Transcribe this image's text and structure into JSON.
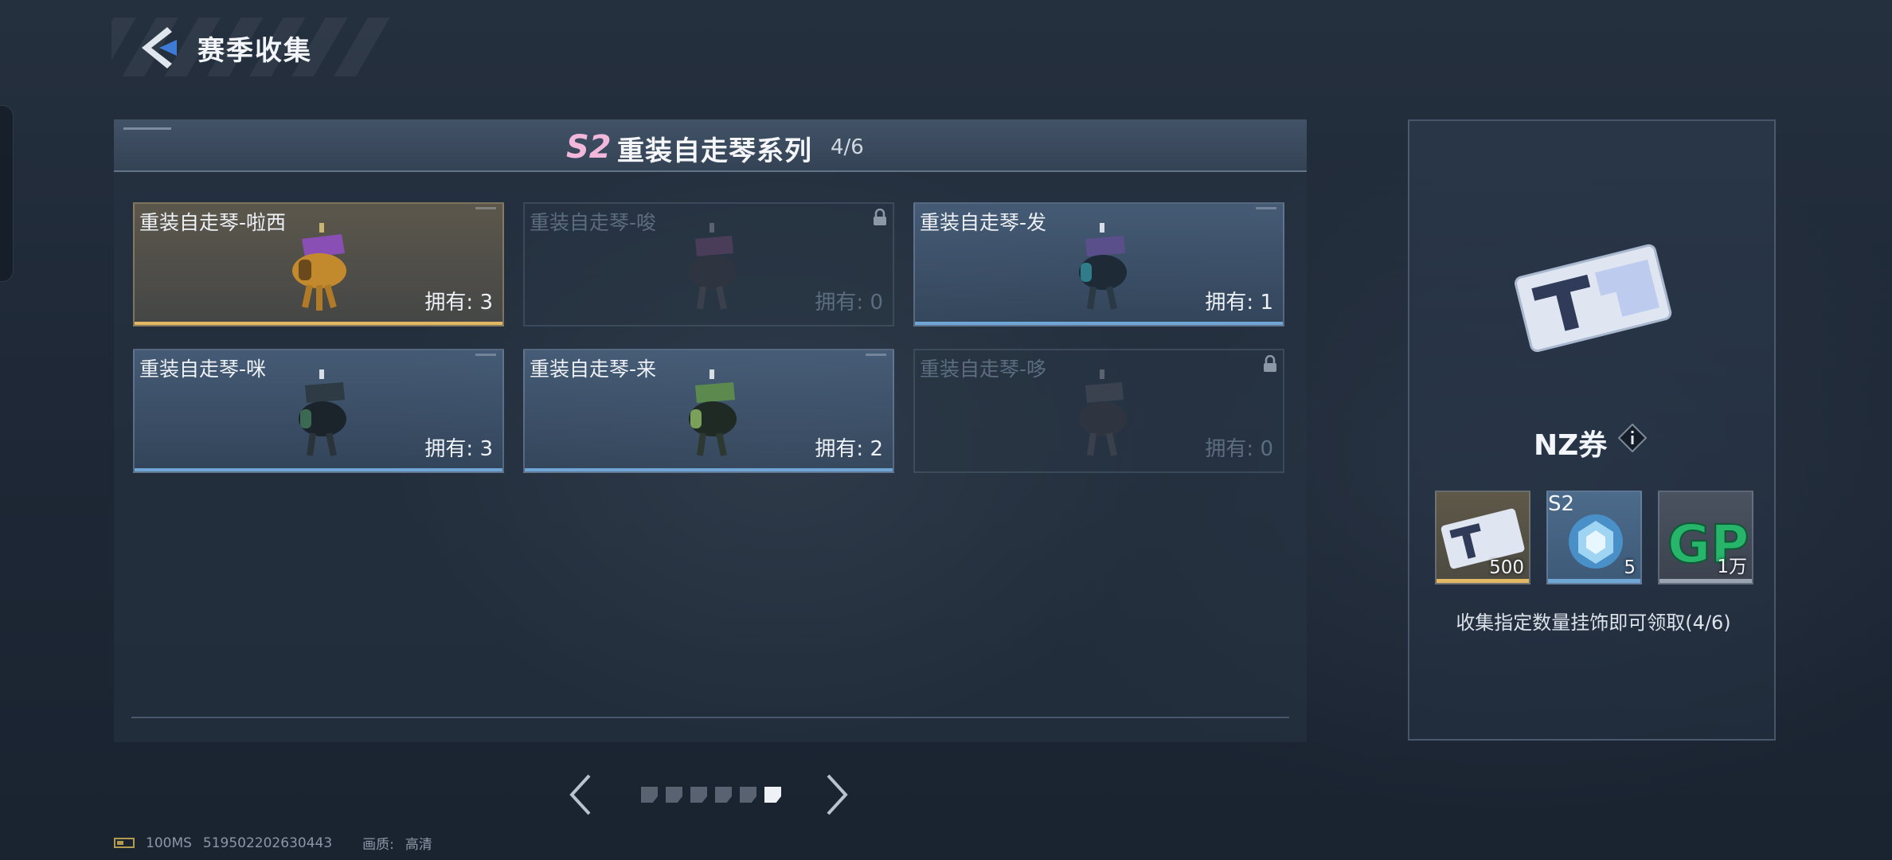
{
  "header": {
    "title": "赛季收集"
  },
  "series": {
    "season_badge": "S2",
    "title": "重装自走琴系列",
    "progress": "4/6",
    "cards": [
      {
        "name": "重装自走琴-啦西",
        "count": "拥有: 3",
        "state": "owned",
        "rarity": "gold",
        "locked": false
      },
      {
        "name": "重装自走琴-唆",
        "count": "拥有: 0",
        "state": "not_owned",
        "rarity": "blue",
        "locked": true
      },
      {
        "name": "重装自走琴-发",
        "count": "拥有: 1",
        "state": "owned",
        "rarity": "blue",
        "locked": false
      },
      {
        "name": "重装自走琴-咪",
        "count": "拥有: 3",
        "state": "owned",
        "rarity": "blue",
        "locked": false
      },
      {
        "name": "重装自走琴-来",
        "count": "拥有: 2",
        "state": "owned",
        "rarity": "blue",
        "locked": false
      },
      {
        "name": "重装自走琴-哆",
        "count": "拥有: 0",
        "state": "not_owned",
        "rarity": "blue",
        "locked": true
      }
    ]
  },
  "pagination": {
    "total_pages": 6,
    "current_page": 6
  },
  "reward": {
    "name": "NZ券",
    "items": [
      {
        "icon": "nz-ticket-icon",
        "label": "",
        "qty": "500",
        "rarity_color": "#e2b864"
      },
      {
        "icon": "s2-crystal-icon",
        "label": "S2",
        "qty": "5",
        "rarity_color": "#6fa6d6"
      },
      {
        "icon": "gp-currency-icon",
        "label": "",
        "qty": "1万",
        "rarity_color": "#9aa4b1"
      }
    ],
    "hint": "收集指定数量挂饰即可领取(4/6)"
  },
  "status": {
    "ping": "100MS",
    "uid": "519502202630443",
    "quality_label": "画质:",
    "quality_value": "高清"
  },
  "colors": {
    "gold": "#e2b864",
    "blue": "#6fa6d6",
    "badge": "#f1b8dc"
  }
}
